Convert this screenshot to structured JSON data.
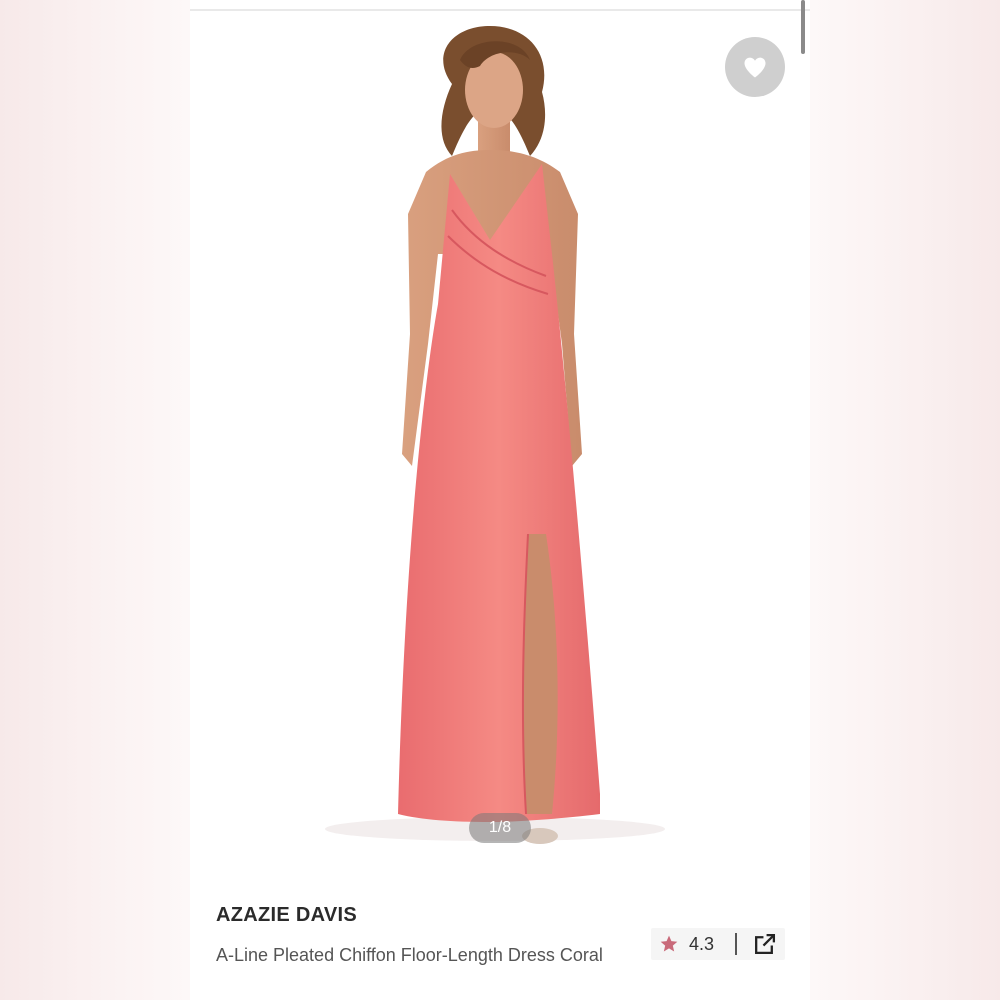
{
  "gallery": {
    "counter": "1/8",
    "current": 1,
    "total": 8
  },
  "favorite": {
    "icon": "heart-icon",
    "color": "#cfcfcf"
  },
  "product": {
    "brand": "AZAZIE DAVIS",
    "description": "A-Line Pleated Chiffon Floor-Length Dress Coral",
    "rating": "4.3",
    "dress_color": "#f27c7c"
  },
  "icons": {
    "rating": "star-icon",
    "share": "external-link-icon"
  },
  "colors": {
    "star": "#c96a7a",
    "text_primary": "#2b2b2b",
    "text_secondary": "#555555"
  }
}
